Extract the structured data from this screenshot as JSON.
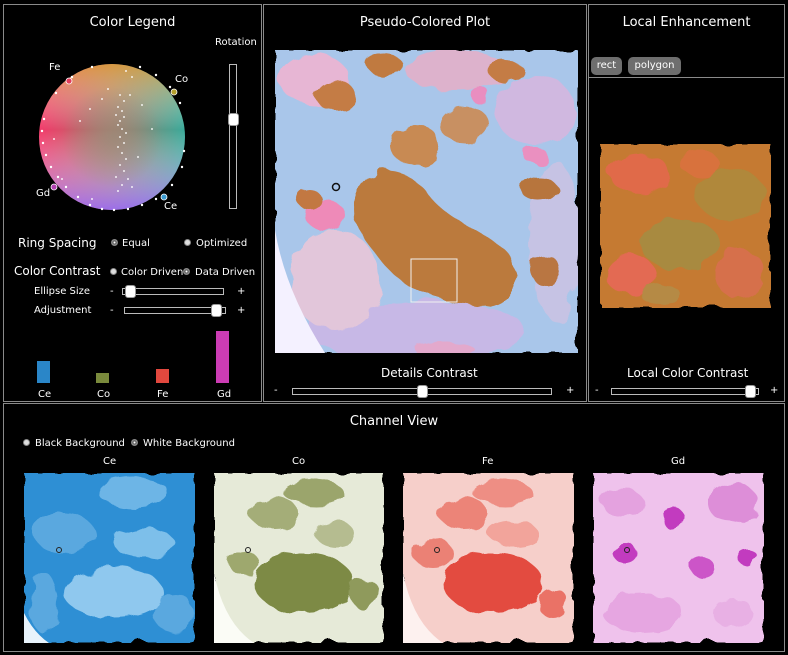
{
  "color_legend": {
    "title": "Color Legend",
    "rotation_label": "Rotation",
    "vertex_labels": [
      "Fe",
      "Co",
      "Gd",
      "Ce"
    ],
    "ring_spacing_label": "Ring Spacing",
    "ring_spacing_options": [
      "Equal",
      "Optimized"
    ],
    "ring_spacing_selected": "Equal",
    "color_contrast_label": "Color Contrast",
    "color_contrast_options": [
      "Color Driven",
      "Data Driven"
    ],
    "color_contrast_selected": "Data Driven",
    "ellipse_size_label": "Ellipse Size",
    "ellipse_size_value": 0.03,
    "adjustment_label": "Adjustment",
    "adjustment_value": 0.96,
    "rotation_value": 0.5,
    "minus": "-",
    "plus": "+",
    "bars": [
      {
        "label": "Ce",
        "color": "#2a86c8",
        "value": 0.42
      },
      {
        "label": "Co",
        "color": "#7a8a3c",
        "value": 0.2
      },
      {
        "label": "Fe",
        "color": "#e2483e",
        "value": 0.26
      },
      {
        "label": "Gd",
        "color": "#cc3cb4",
        "value": 1.0
      }
    ]
  },
  "pseudo_plot": {
    "title": "Pseudo-Colored Plot",
    "contrast_label": "Details Contrast",
    "contrast_value": 0.5,
    "minus": "-",
    "plus": "+"
  },
  "local_enhancement": {
    "title": "Local Enhancement",
    "tools": [
      "rect",
      "polygon"
    ],
    "contrast_label": "Local Color Contrast",
    "contrast_value": 0.98,
    "minus": "-",
    "plus": "+"
  },
  "channel_view": {
    "title": "Channel View",
    "background_options": [
      "Black Background",
      "White Background"
    ],
    "background_selected": "White Background",
    "channels": [
      {
        "label": "Ce",
        "color": "#2a8ad0"
      },
      {
        "label": "Co",
        "color": "#7d8a45"
      },
      {
        "label": "Fe",
        "color": "#e34b3f"
      },
      {
        "label": "Gd",
        "color": "#c23bbf"
      }
    ]
  }
}
